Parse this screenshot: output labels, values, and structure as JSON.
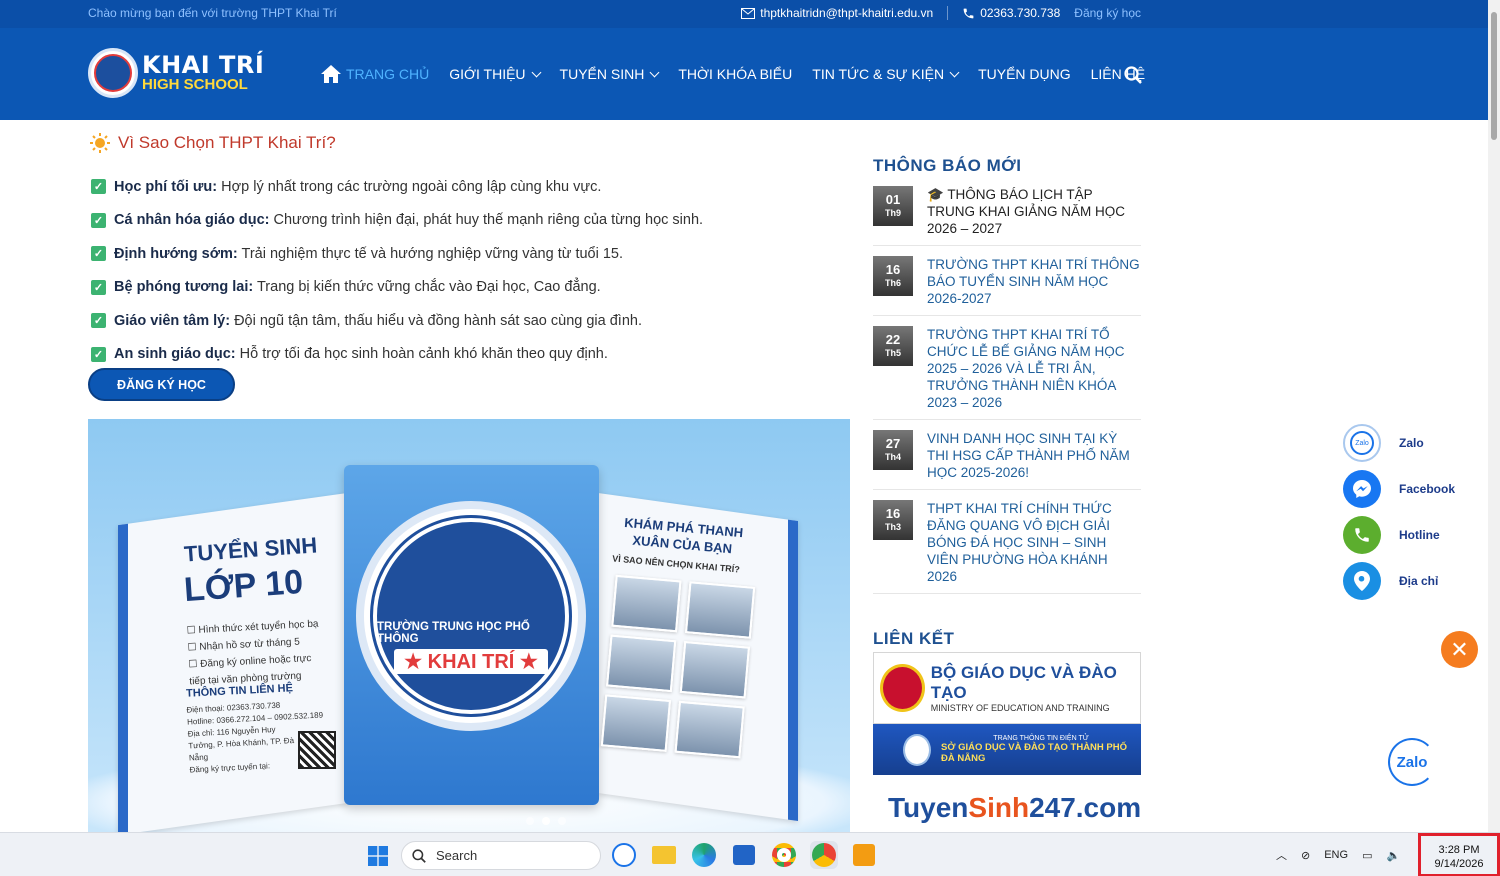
{
  "topbar": {
    "welcome": "Chào mừng bạn đến với trường THPT Khai Trí",
    "email": "thptkhaitridn@thpt-khaitri.edu.vn",
    "phone": "02363.730.738",
    "register": "Đăng ký học"
  },
  "logo": {
    "line1": "KHAI TRÍ",
    "line2": "HIGH SCHOOL"
  },
  "nav": {
    "home": "TRANG CHỦ",
    "about": "GIỚI THIỆU",
    "admissions": "TUYỂN SINH",
    "timetable": "THỜI KHÓA BIỂU",
    "news": "TIN TỨC & SỰ KIỆN",
    "recruitment": "TUYỂN DỤNG",
    "contact": "LIÊN HỆ"
  },
  "why": {
    "title": "Vì Sao Chọn THPT Khai Trí?",
    "items": [
      {
        "bold": "Học phí tối ưu:",
        "text": " Hợp lý nhất trong các trường ngoài công lập cùng khu vực."
      },
      {
        "bold": "Cá nhân hóa giáo dục:",
        "text": " Chương trình hiện đại, phát huy thế mạnh riêng của từng học sinh."
      },
      {
        "bold": "Định hướng sớm:",
        "text": " Trải nghiệm thực tế và hướng nghiệp vững vàng từ tuổi 15."
      },
      {
        "bold": "Bệ phóng tương lai:",
        "text": " Trang bị kiến thức vững chắc vào Đại học, Cao đẳng."
      },
      {
        "bold": "Giáo viên tâm lý:",
        "text": " Đội ngũ tận tâm, thấu hiểu và đồng hành sát sao cùng gia đình."
      },
      {
        "bold": "An sinh giáo dục:",
        "text": " Hỗ trợ tối đa học sinh hoàn cảnh khó khăn theo quy định."
      }
    ],
    "register_button": "ĐĂNG KÝ HỌC"
  },
  "banner": {
    "left_title1": "TUYỂN SINH",
    "left_title2": "LỚP 10",
    "left_lines": [
      "Hình thức xét tuyển học bạ",
      "Nhận hồ sơ từ tháng 5",
      "Đăng ký online hoặc trực tiếp tại văn phòng trường"
    ],
    "contact_title": "THÔNG TIN LIÊN HỆ",
    "contact_lines": [
      "Điện thoại: 02363.730.738",
      "Hotline: 0366.272.104 – 0902.532.189",
      "Địa chỉ: 116 Nguyễn Huy Tưởng, P. Hòa Khánh, TP. Đà Nẵng",
      "Đăng ký trực tuyến tại:"
    ],
    "emblem_line1": "TRƯỜNG TRUNG HỌC PHỔ THÔNG",
    "emblem_line2": "★ KHAI TRÍ ★",
    "right_title": "KHÁM PHÁ THANH XUÂN CỦA BẠN",
    "right_sub": "VÌ SAO NÊN CHỌN KHAI TRÍ?"
  },
  "sidebar": {
    "notices_title": "THÔNG BÁO MỚI",
    "notices": [
      {
        "day": "01",
        "month": "Th9",
        "title": "🎓 THÔNG BÁO LỊCH TẬP TRUNG KHAI GIẢNG NĂM HỌC 2026 – 2027"
      },
      {
        "day": "16",
        "month": "Th6",
        "title": "TRƯỜNG THPT KHAI TRÍ THÔNG BÁO TUYỂN SINH NĂM HỌC 2026-2027"
      },
      {
        "day": "22",
        "month": "Th5",
        "title": "TRƯỜNG THPT KHAI TRÍ TỔ CHỨC LỄ BẾ GIẢNG NĂM HỌC 2025 – 2026 VÀ LỄ TRI ÂN, TRƯỞNG THÀNH NIÊN KHÓA 2023 – 2026"
      },
      {
        "day": "27",
        "month": "Th4",
        "title": "VINH DANH HỌC SINH TẠI KỲ THI HSG CẤP THÀNH PHỐ NĂM HỌC 2025-2026!"
      },
      {
        "day": "16",
        "month": "Th3",
        "title": "THPT KHAI TRÍ CHÍNH THỨC ĐĂNG QUANG VÔ ĐỊCH GIẢI BÓNG ĐÁ HỌC SINH – SINH VIÊN PHƯỜNG HÒA KHÁNH 2026"
      }
    ],
    "links_title": "LIÊN KẾT",
    "link1_title": "BỘ GIÁO DỤC VÀ ĐÀO TẠO",
    "link1_sub": "MINISTRY OF EDUCATION AND TRAINING",
    "link2_line1": "TRANG THÔNG TIN ĐIỆN TỬ",
    "link2_line2": "SỞ GIÁO DỤC VÀ ĐÀO TẠO THÀNH PHỐ ĐÀ NẴNG",
    "link3_a": "Tuyen",
    "link3_b": "Sinh",
    "link3_c": "247.com"
  },
  "floating": {
    "zalo": "Zalo",
    "facebook": "Facebook",
    "hotline": "Hotline",
    "address": "Địa chỉ",
    "zalo_fab": "Zalo",
    "zalo_small": "Zalo"
  },
  "taskbar": {
    "search": "Search",
    "lang": "ENG",
    "time": "3:28 PM",
    "date": "9/14/2026"
  },
  "colors": {
    "primary": "#0c57b4",
    "accent_red": "#c0392b",
    "check_green": "#3cb371",
    "orange": "#f57c1f"
  }
}
